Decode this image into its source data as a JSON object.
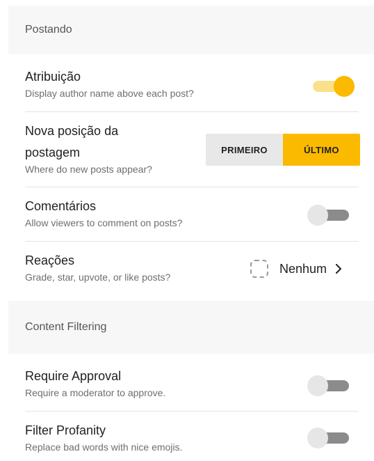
{
  "sections": {
    "posting": {
      "title": "Postando"
    },
    "filtering": {
      "title": "Content Filtering"
    }
  },
  "settings": {
    "attribution": {
      "title": "Atribuição",
      "subtitle": "Display author name above each post?",
      "enabled": true
    },
    "new_post_position": {
      "title_line1": "Nova posição da",
      "title_line2": "postagem",
      "subtitle": "Where do new posts appear?",
      "options": [
        "PRIMEIRO",
        "ÚLTIMO"
      ],
      "selected": "ÚLTIMO"
    },
    "comments": {
      "title": "Comentários",
      "subtitle": "Allow viewers to comment on posts?",
      "enabled": false
    },
    "reactions": {
      "title": "Reações",
      "subtitle": "Grade, star, upvote, or like posts?",
      "value": "Nenhum"
    },
    "require_approval": {
      "title": "Require Approval",
      "subtitle": "Require a moderator to approve.",
      "enabled": false
    },
    "filter_profanity": {
      "title": "Filter Profanity",
      "subtitle": "Replace bad words with nice emojis.",
      "enabled": false
    }
  },
  "colors": {
    "accent": "#fbb900",
    "accent_light": "#fbe08a",
    "section_bg": "#f7f7f7",
    "toggle_off_track": "#8b8b8b",
    "toggle_off_thumb": "#e6e6e6"
  },
  "icons": {
    "reactions_placeholder": "dashed-square-icon",
    "reactions_chevron": "chevron-right-icon"
  }
}
